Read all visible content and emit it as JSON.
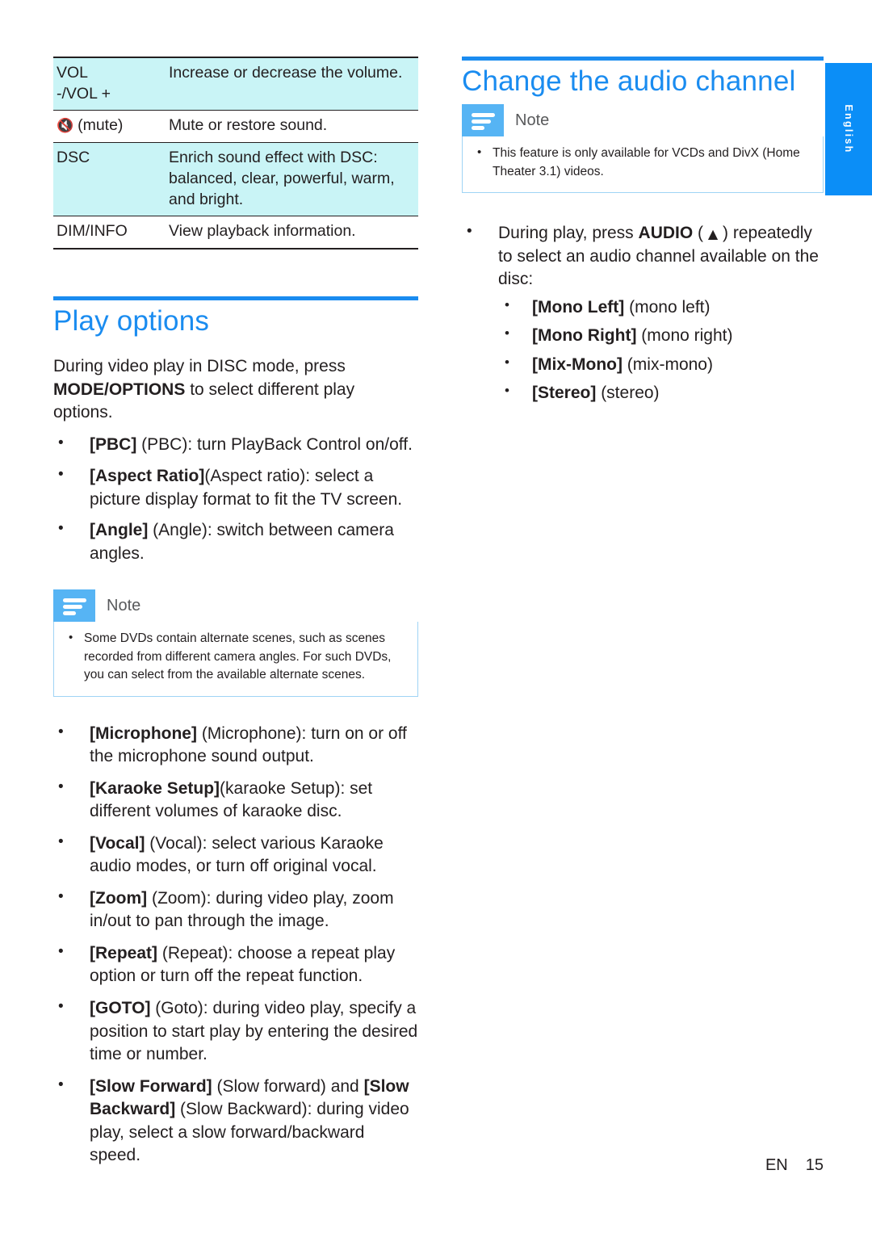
{
  "document": {
    "language_tab": "English",
    "footer": {
      "locale": "EN",
      "page_number": "15"
    }
  },
  "colors": {
    "accent_blue": "#1a8cf0",
    "tab_blue": "#0b8ef7",
    "note_icon_blue": "#56b4f4",
    "table_tint": "#c9f4f6",
    "note_border": "#9fd4f5",
    "text": "#231f20",
    "note_title_gray": "#58595b"
  },
  "left_column": {
    "table": {
      "rows": [
        {
          "key": "VOL -/VOL +",
          "key_line1": "VOL",
          "key_line2": "-/VOL +",
          "description": "Increase or decrease the volume.",
          "tinted": true
        },
        {
          "key": "(mute)",
          "icon": "mute-speaker-icon",
          "icon_glyph": "🔇",
          "key_text": " (mute)",
          "description": "Mute or restore sound.",
          "tinted": false
        },
        {
          "key": "DSC",
          "description": "Enrich sound effect with DSC: balanced, clear, powerful, warm, and bright.",
          "tinted": true
        },
        {
          "key": "DIM/INFO",
          "description": "View playback information.",
          "tinted": false
        }
      ]
    },
    "section": {
      "title": "Play options",
      "intro_part1": "During video play in DISC mode, press ",
      "intro_bold": "MODE/OPTIONS",
      "intro_part2": " to select different play options.",
      "bullets_top": [
        {
          "bold": "[PBC]",
          "rest": " (PBC): turn PlayBack Control on/off."
        },
        {
          "bold": "[Aspect Ratio]",
          "rest": "(Aspect ratio): select a picture display format to fit the TV screen."
        },
        {
          "bold": "[Angle]",
          "rest": " (Angle): switch between camera angles."
        }
      ],
      "note": {
        "title": "Note",
        "items": [
          "Some DVDs contain alternate scenes, such as scenes recorded from different camera angles. For such DVDs, you can select from the available alternate scenes."
        ]
      },
      "bullets_bottom": [
        {
          "bold": "[Microphone]",
          "rest": " (Microphone): turn on or off the microphone sound output."
        },
        {
          "bold": "[Karaoke Setup]",
          "rest": "(karaoke Setup): set different volumes of karaoke disc."
        },
        {
          "bold": "[Vocal]",
          "rest": " (Vocal): select various Karaoke audio modes, or turn off original vocal."
        },
        {
          "bold": "[Zoom]",
          "rest": " (Zoom): during video play, zoom in/out to pan through the image."
        },
        {
          "bold": "[Repeat]",
          "rest": " (Repeat): choose a repeat play option or turn off the repeat function."
        },
        {
          "bold": "[GOTO]",
          "rest": " (Goto): during video play, specify a position to start play by entering the desired time or number."
        },
        {
          "bold": "[Slow Forward]",
          "rest": " (Slow forward) and ",
          "bold2": "[Slow Backward]",
          "rest2": " (Slow Backward): during video play, select a slow forward/backward speed."
        }
      ]
    }
  },
  "right_column": {
    "section": {
      "title": "Change the audio channel",
      "note": {
        "title": "Note",
        "items": [
          "This feature is only available for VCDs and DivX (Home Theater 3.1) videos."
        ]
      },
      "main_bullet": {
        "part1": "During play, press ",
        "bold": "AUDIO",
        "part2": " ( ",
        "triangle": "▲",
        "part3": " ) repeatedly to select an audio channel available on the disc:"
      },
      "sub_bullets": [
        {
          "bold": "[Mono Left]",
          "rest": " (mono left)"
        },
        {
          "bold": "[Mono Right]",
          "rest": " (mono right)"
        },
        {
          "bold": "[Mix-Mono]",
          "rest": " (mix-mono)"
        },
        {
          "bold": "[Stereo]",
          "rest": " (stereo)"
        }
      ]
    }
  }
}
